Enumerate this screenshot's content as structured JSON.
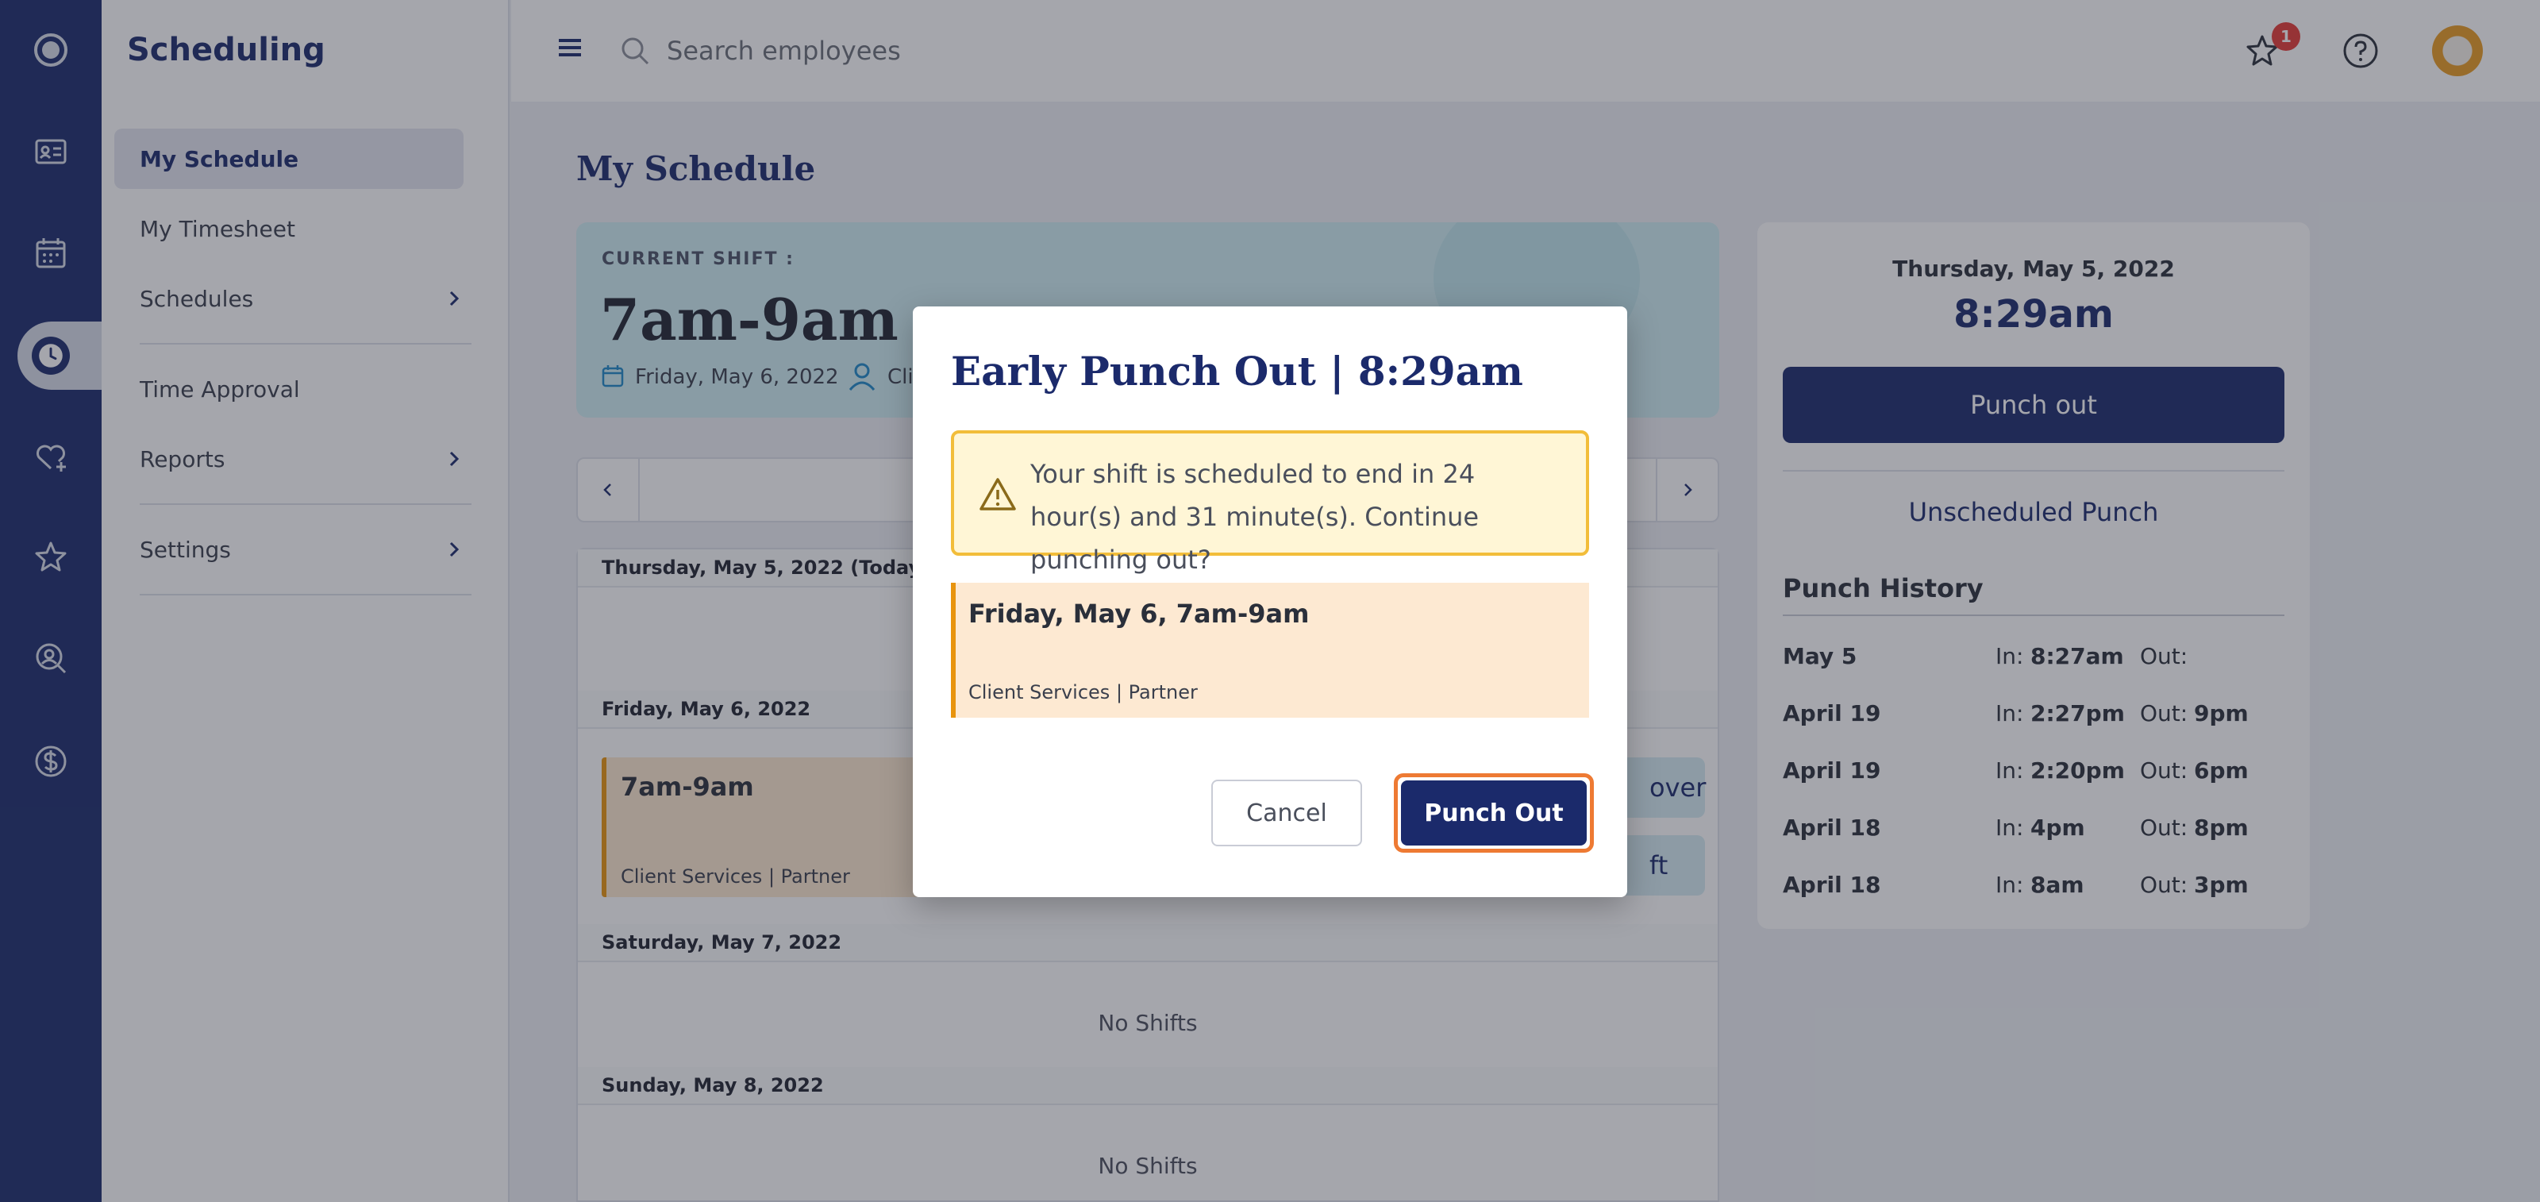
{
  "sidenav": {
    "title": "Scheduling",
    "items": [
      {
        "label": "My Schedule"
      },
      {
        "label": "My Timesheet"
      },
      {
        "label": "Schedules"
      },
      {
        "label": "Time Approval"
      },
      {
        "label": "Reports"
      },
      {
        "label": "Settings"
      }
    ]
  },
  "topbar": {
    "search_placeholder": "Search employees",
    "notification_count": "1"
  },
  "main": {
    "title": "My Schedule",
    "current_shift": {
      "label": "CURRENT SHIFT :",
      "time": "7am-9am",
      "date": "Friday, May 6, 2022",
      "client_partial": "Cli"
    },
    "days": [
      {
        "header": "Thursday, May 5, 2022 (Today)"
      },
      {
        "header": "Friday, May 6, 2022",
        "shift_time": "7am-9am",
        "shift_sub": "Client Services | Partner",
        "btn1": "over",
        "btn2": "ft"
      },
      {
        "header": "Saturday, May 7, 2022",
        "empty": "No Shifts"
      },
      {
        "header": "Sunday, May 8, 2022",
        "empty": "No Shifts"
      }
    ]
  },
  "punch_panel": {
    "date": "Thursday, May 5, 2022",
    "time": "8:29am",
    "punch_label": "Punch out",
    "unscheduled_label": "Unscheduled Punch",
    "history_title": "Punch History",
    "in_label": "In:",
    "out_label": "Out:",
    "history": [
      {
        "date": "May 5",
        "in": "8:27am",
        "out": ""
      },
      {
        "date": "April 19",
        "in": "2:27pm",
        "out": "9pm"
      },
      {
        "date": "April 19",
        "in": "2:20pm",
        "out": "6pm"
      },
      {
        "date": "April 18",
        "in": "4pm",
        "out": "8pm"
      },
      {
        "date": "April 18",
        "in": "8am",
        "out": "3pm"
      }
    ]
  },
  "modal": {
    "title": "Early Punch Out | 8:29am",
    "warning": "Your shift is scheduled to end in 24 hour(s) and 31 minute(s). Continue punching out?",
    "shift_title": "Friday, May 6, 7am-9am",
    "shift_sub": "Client Services |  Partner",
    "cancel_label": "Cancel",
    "confirm_label": "Punch Out"
  },
  "colors": {
    "brand": "#1b2a6b",
    "accent_orange": "#ee7a33",
    "warning_border": "#f2bd3a",
    "shift_highlight": "#e8940e"
  }
}
